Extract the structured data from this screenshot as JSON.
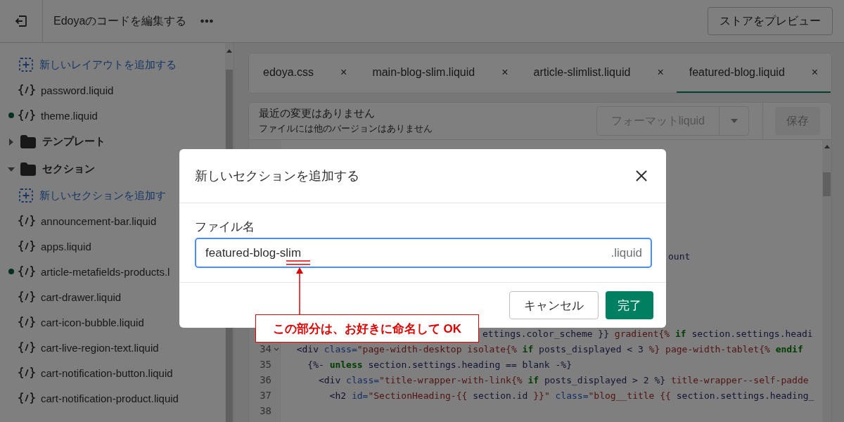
{
  "topbar": {
    "title": "Edoyaのコードを編集する",
    "preview_button": "ストアをプレビュー"
  },
  "sidebar": {
    "items": [
      {
        "kind": "add",
        "label": "新しいレイアウトを追加する"
      },
      {
        "kind": "file",
        "label": "password.liquid",
        "modified": false
      },
      {
        "kind": "file",
        "label": "theme.liquid",
        "modified": true
      },
      {
        "kind": "folder",
        "label": "テンプレート",
        "expanded": false
      },
      {
        "kind": "folder",
        "label": "セクション",
        "expanded": true,
        "children": [
          {
            "kind": "add",
            "label": "新しいセクションを追加す"
          },
          {
            "kind": "file",
            "label": "announcement-bar.liquid",
            "modified": false
          },
          {
            "kind": "file",
            "label": "apps.liquid",
            "modified": false
          },
          {
            "kind": "file",
            "label": "article-metafields-products.l",
            "modified": true
          },
          {
            "kind": "file",
            "label": "cart-drawer.liquid",
            "modified": false
          },
          {
            "kind": "file",
            "label": "cart-icon-bubble.liquid",
            "modified": false
          },
          {
            "kind": "file",
            "label": "cart-live-region-text.liquid",
            "modified": false
          },
          {
            "kind": "file",
            "label": "cart-notification-button.liquid",
            "modified": false
          },
          {
            "kind": "file",
            "label": "cart-notification-product.liquid",
            "modified": false
          }
        ]
      }
    ]
  },
  "tabs": [
    {
      "label": "edoya.css",
      "close": "×",
      "selected": false
    },
    {
      "label": "main-blog-slim.liquid",
      "close": "×",
      "selected": false
    },
    {
      "label": "article-slimlist.liquid",
      "close": "×",
      "selected": false
    },
    {
      "label": "featured-blog.liquid",
      "close": "×",
      "selected": true
    }
  ],
  "editor": {
    "status": "最近の変更はありません",
    "note": "ファイルには他のバージョンはありません",
    "format_button": "フォーマットliquid",
    "format_disabled": true,
    "save_button": "保存",
    "save_disabled": true,
    "lines": [
      {
        "kind": "covered"
      },
      {
        "kind": "covered"
      },
      {
        "kind": "covered"
      },
      {
        "kind": "covered"
      },
      {
        "kind": "covered"
      },
      {
        "kind": "covered"
      },
      {
        "kind": "covered"
      },
      {
        "kind": "after_dialog",
        "segments": [
          {
            "kind": "plain",
            "text": "ount"
          }
        ]
      },
      {
        "kind": "covered"
      },
      {
        "kind": "covered"
      },
      {
        "kind": "covered"
      },
      {
        "kind": "covered"
      },
      {
        "kind": "after_callout",
        "segments": [
          {
            "kind": "plain",
            "text": "ettings.color_scheme }}"
          },
          {
            "kind": "string",
            "text": " gradient{% "
          },
          {
            "kind": "keyword",
            "text": "if"
          },
          {
            "kind": "plain",
            "text": " section.settings.headi"
          }
        ]
      },
      {
        "kind": "code",
        "number": "34",
        "foldable": true,
        "segments": [
          {
            "kind": "tag",
            "text": "  <div"
          },
          {
            "kind": "attr",
            "text": " class="
          },
          {
            "kind": "string",
            "text": "\"page-width-desktop isolate{% "
          },
          {
            "kind": "keyword",
            "text": "if"
          },
          {
            "kind": "plain",
            "text": " posts_displayed < 3 "
          },
          {
            "kind": "string",
            "text": "%} page-width-tablet{% "
          },
          {
            "kind": "keyword",
            "text": "endif"
          }
        ]
      },
      {
        "kind": "code",
        "number": "35",
        "foldable": false,
        "segments": [
          {
            "kind": "plain",
            "text": "    {%- "
          },
          {
            "kind": "keyword",
            "text": "unless"
          },
          {
            "kind": "plain",
            "text": " section.settings.heading == blank -%}"
          }
        ]
      },
      {
        "kind": "code",
        "number": "36",
        "foldable": false,
        "segments": [
          {
            "kind": "tag",
            "text": "      <div"
          },
          {
            "kind": "attr",
            "text": " class="
          },
          {
            "kind": "string",
            "text": "\"title-wrapper-with-link{% "
          },
          {
            "kind": "keyword",
            "text": "if"
          },
          {
            "kind": "plain",
            "text": " posts_displayed > 2 %}"
          },
          {
            "kind": "string",
            "text": " title-wrapper--self-padde"
          }
        ]
      },
      {
        "kind": "code",
        "number": "37",
        "foldable": false,
        "segments": [
          {
            "kind": "tag",
            "text": "        <h2"
          },
          {
            "kind": "attr",
            "text": " id="
          },
          {
            "kind": "string",
            "text": "\"SectionHeading-{{ "
          },
          {
            "kind": "plain",
            "text": "section.id"
          },
          {
            "kind": "string",
            "text": " }}\""
          },
          {
            "kind": "attr",
            "text": " class="
          },
          {
            "kind": "string",
            "text": "\"blog__title {{ "
          },
          {
            "kind": "plain",
            "text": "section.settings.heading_"
          }
        ]
      },
      {
        "kind": "code",
        "number": "38",
        "foldable": false
      }
    ]
  },
  "dialog": {
    "title": "新しいセクションを追加する",
    "label": "ファイル名",
    "value": "featured-blog-slim",
    "suffix": ".liquid",
    "cancel": "キャンセル",
    "confirm": "完了"
  },
  "annotation": {
    "text": "この部分は、お好きに命名して OK"
  }
}
